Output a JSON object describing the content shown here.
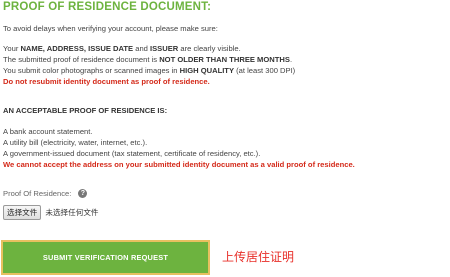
{
  "title": "PROOF OF RESIDENCE DOCUMENT:",
  "intro": "To avoid delays when verifying your account, please make sure:",
  "requirements": {
    "r1_a": "Your ",
    "r1_b": "NAME, ADDRESS, ISSUE DATE",
    "r1_c": " and ",
    "r1_d": "ISSUER",
    "r1_e": " are clearly visible.",
    "r2_a": "The submitted proof of residence document is ",
    "r2_b": "NOT OLDER THAN THREE MONTHS",
    "r2_c": ".",
    "r3_a": "You submit color photographs or scanned images in ",
    "r3_b": "HIGH QUALITY",
    "r3_c": " (at least 300 DPI)",
    "r4": "Do not resubmit identity document as proof of residence."
  },
  "acceptable_heading": "AN ACCEPTABLE PROOF OF RESIDENCE IS:",
  "acceptable_items": [
    "A bank account statement.",
    "A utility bill (electricity, water, internet, etc.).",
    "A government-issued document (tax statement, certificate of residency, etc.)."
  ],
  "warning": "We cannot accept the address on your submitted identity document as a valid proof of residence.",
  "field": {
    "label": "Proof Of Residence:",
    "help_icon": "?",
    "file_button": "选择文件",
    "file_status": "未选择任何文件"
  },
  "submit_label": "SUBMIT VERIFICATION REQUEST",
  "annotation": "上传居住证明",
  "colors": {
    "accent_green": "#6db33f",
    "warning_red": "#d42a1a",
    "annotation_red": "#e8302a",
    "highlight_border": "#e8c060"
  }
}
